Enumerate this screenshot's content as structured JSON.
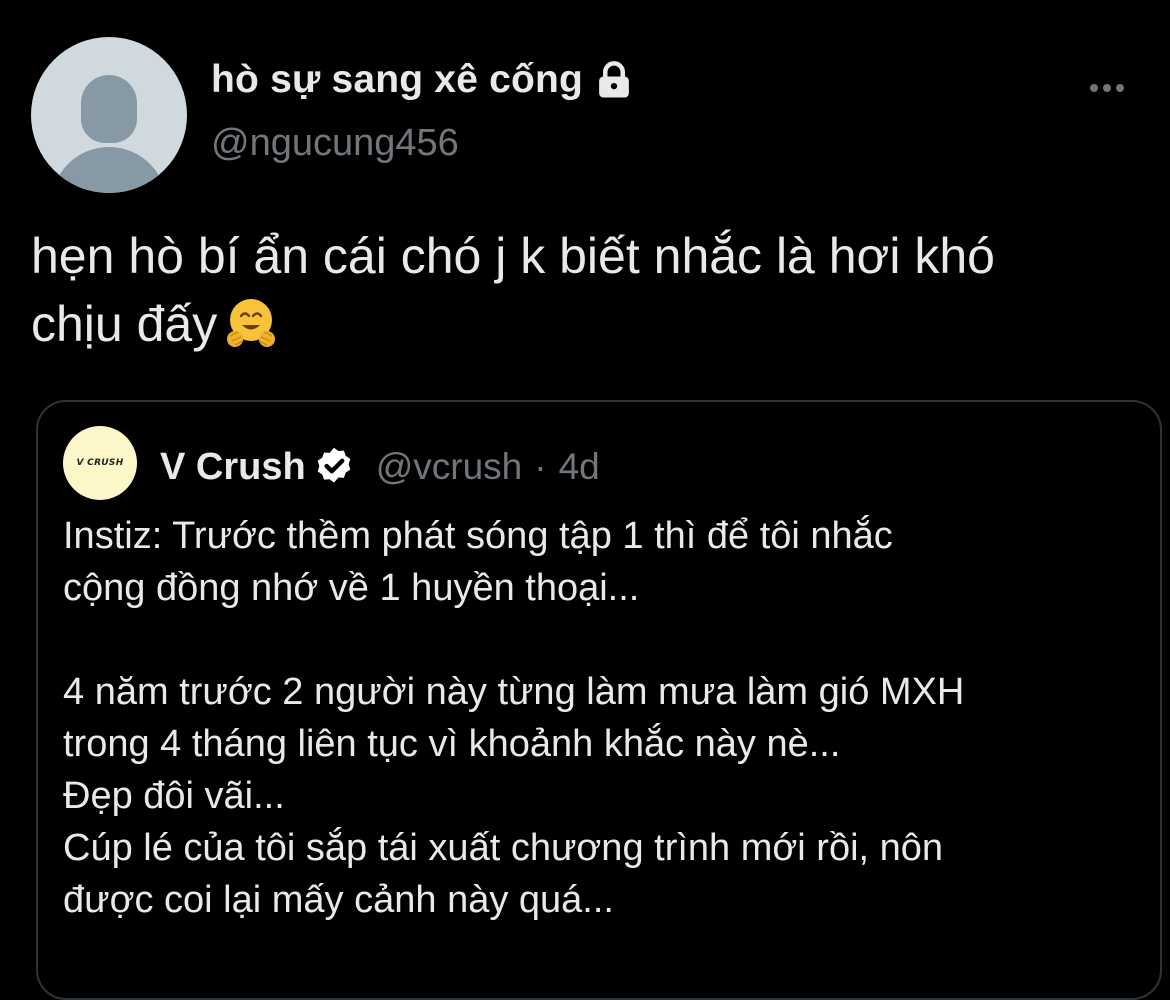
{
  "author": {
    "display_name": "hò sự sang xê cống",
    "handle": "@ngucung456",
    "protected_icon": "lock-icon",
    "avatar_icon": "default-avatar-icon"
  },
  "tweet": {
    "text_lines": [
      "hẹn hò bí ẩn cái chó j k biết nhắc là hơi khó",
      "chịu đấy"
    ],
    "emoji": "hugging-face-emoji"
  },
  "more_icon": "more-horizontal-icon",
  "quoted": {
    "avatar_text": "V CRUSH",
    "name": "V Crush",
    "verified_icon": "verified-badge-icon",
    "handle": "@vcrush",
    "separator": "·",
    "time": "4d",
    "body_lines": [
      "Instiz: Trước thềm phát sóng tập 1 thì để tôi nhắc",
      "cộng đồng nhớ về 1 huyền thoại...",
      "",
      "4 năm trước 2 người này từng làm mưa làm gió MXH",
      "trong 4 tháng liên tục vì khoảnh khắc này nè...",
      "Đẹp đôi vãi...",
      "Cúp lé của tôi sắp tái xuất chương trình mới rồi, nôn",
      "được coi lại mấy cảnh này quá..."
    ]
  },
  "colors": {
    "background": "#000000",
    "text": "#e7e9ea",
    "secondary": "#71767b",
    "border": "#2f3336"
  }
}
